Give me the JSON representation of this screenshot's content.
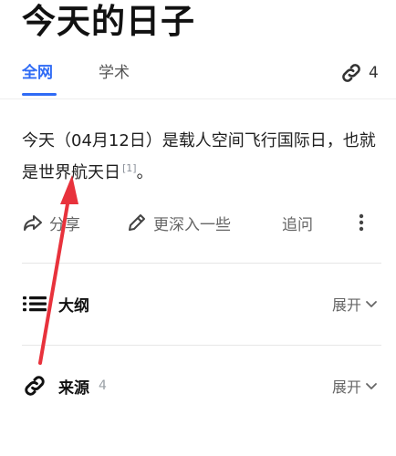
{
  "header": {
    "title": "今天的日子"
  },
  "tabs": {
    "active": "全网",
    "inactive": "学术",
    "link_count": "4"
  },
  "answer": {
    "text": "今天（04月12日）是载人空间飞行国际日，也就是世界航天日",
    "citation": "[1]",
    "end": "。"
  },
  "actions": {
    "share": "分享",
    "deeper": "更深入一些",
    "ask": "追问"
  },
  "sections": {
    "outline": {
      "title": "大纲",
      "expand": "展开"
    },
    "sources": {
      "title": "来源",
      "count": "4",
      "expand": "展开"
    }
  },
  "icons": {
    "link": "link-icon",
    "share": "share-icon",
    "pen": "pen-icon",
    "more": "more-vertical-icon",
    "list": "list-icon",
    "chevron": "chevron-down-icon"
  },
  "colors": {
    "accent": "#2f6bf5",
    "annotation_arrow": "#e8323c"
  }
}
